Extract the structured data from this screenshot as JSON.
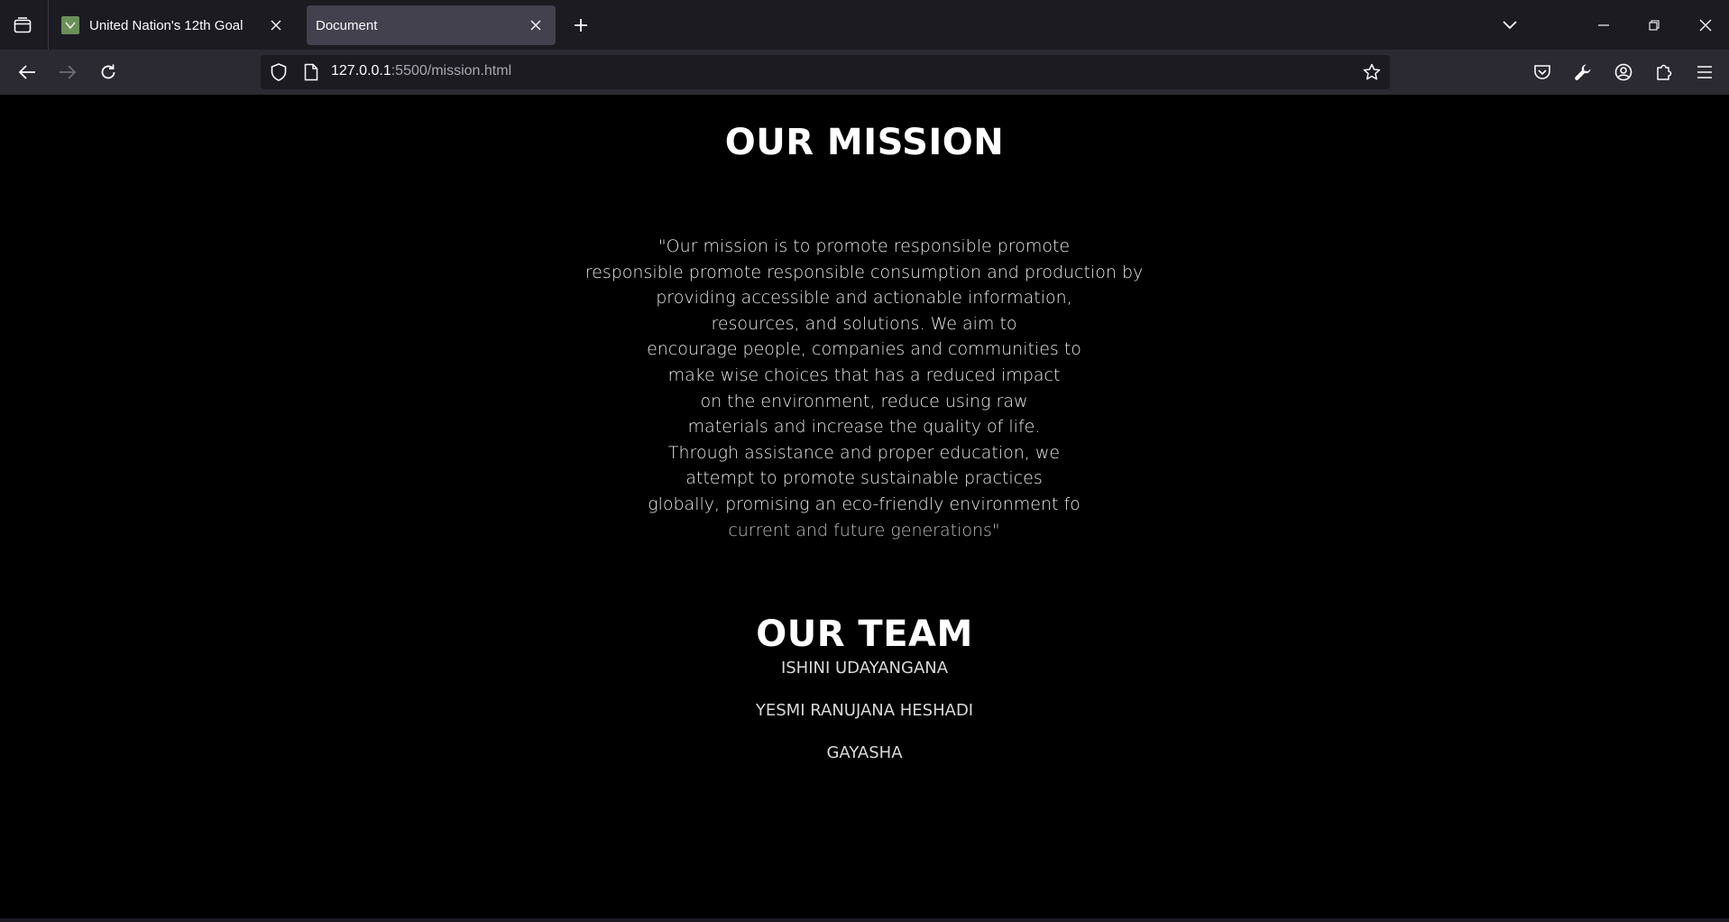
{
  "browser": {
    "tabs": [
      {
        "title": "United Nation's 12th Goal",
        "active": false
      },
      {
        "title": "Document",
        "active": true
      }
    ],
    "url": {
      "host": "127.0.0.1",
      "rest": ":5500/mission.html"
    }
  },
  "page": {
    "mission_title": "OUR MISSION",
    "mission_lines": [
      "\"Our mission is to promote responsible promote",
      "responsible promote responsible consumption and production by",
      "providing accessible and actionable information,",
      "resources, and solutions. We aim to",
      "encourage people, companies and communities to",
      "make wise choices that has a reduced impact",
      "on the environment, reduce using raw",
      "materials and increase the quality of life.",
      "Through assistance and proper education, we",
      "attempt to promote sustainable practices",
      "globally, promising an eco-friendly environment fo",
      "current and future generations\""
    ],
    "team_title": "OUR TEAM",
    "team_members": [
      "ISHINI UDAYANGANA",
      "YESMI RANUJANA HESHADI",
      "GAYASHA"
    ]
  },
  "colors": {
    "tabstrip_bg": "#1c1b22",
    "toolbar_bg": "#2b2a33",
    "active_tab_bg": "#42414d",
    "page_bg": "#000000",
    "text": "#ffffff"
  }
}
